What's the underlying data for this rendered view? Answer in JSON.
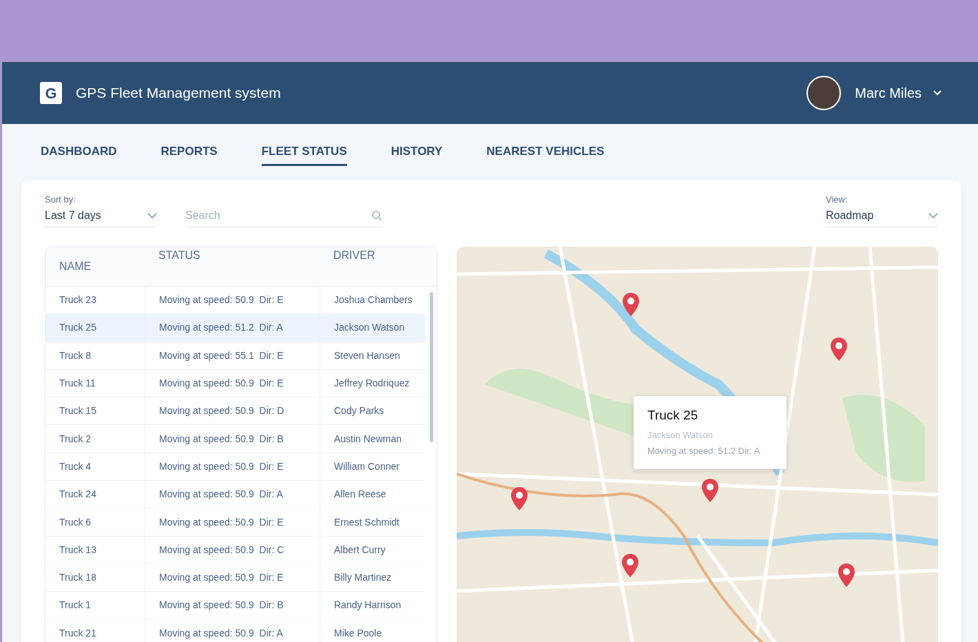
{
  "header": {
    "logo_letter": "G",
    "title": "GPS Fleet Management system",
    "user_name": "Marc Miles"
  },
  "tabs": [
    {
      "label": "DASHBOARD",
      "selected": false
    },
    {
      "label": "REPORTS",
      "selected": false
    },
    {
      "label": "FLEET STATUS",
      "selected": true
    },
    {
      "label": "HISTORY",
      "selected": false
    },
    {
      "label": "NEAREST VEHICLES",
      "selected": false
    }
  ],
  "filters": {
    "sort_label": "Sort by:",
    "sort_value": "Last 7 days",
    "search_placeholder": "Search",
    "view_label": "View:",
    "view_value": "Roadmap"
  },
  "table": {
    "columns": [
      "NAME",
      "STATUS",
      "DRIVER"
    ],
    "rows": [
      {
        "name": "Truck 23",
        "status": "Moving at speed: 50.9  Dir: E",
        "driver": "Joshua Chambers",
        "selected": false
      },
      {
        "name": "Truck 25",
        "status": "Moving at speed: 51.2  Dir: A",
        "driver": "Jackson Watson",
        "selected": true
      },
      {
        "name": "Truck 8",
        "status": "Moving at speed: 55.1  Dir: E",
        "driver": "Steven Hansen",
        "selected": false
      },
      {
        "name": "Truck 11",
        "status": "Moving at speed: 50.9  Dir: E",
        "driver": "Jeffrey Rodriquez",
        "selected": false
      },
      {
        "name": "Truck 15",
        "status": "Moving at speed: 50.9  Dir: D",
        "driver": "Cody Parks",
        "selected": false
      },
      {
        "name": "Truck 2",
        "status": "Moving at speed: 50.9  Dir: B",
        "driver": "Austin Newman",
        "selected": false
      },
      {
        "name": "Truck 4",
        "status": "Moving at speed: 50.9  Dir: E",
        "driver": "William Conner",
        "selected": false
      },
      {
        "name": "Truck 24",
        "status": "Moving at speed: 50.9  Dir: A",
        "driver": "Allen Reese",
        "selected": false
      },
      {
        "name": "Truck 6",
        "status": "Moving at speed: 50.9  Dir: E",
        "driver": "Ernest Schmidt",
        "selected": false
      },
      {
        "name": "Truck 13",
        "status": "Moving at speed: 50.9  Dir: C",
        "driver": "Albert Curry",
        "selected": false
      },
      {
        "name": "Truck 18",
        "status": "Moving at speed: 50.9  Dir: E",
        "driver": "Billy Martinez",
        "selected": false
      },
      {
        "name": "Truck 1",
        "status": "Moving at speed: 50.9  Dir: B",
        "driver": "Randy Harrison",
        "selected": false
      },
      {
        "name": "Truck 21",
        "status": "Moving at speed: 50.9  Dir: A",
        "driver": "Mike Poole",
        "selected": false
      }
    ]
  },
  "map": {
    "tooltip": {
      "title": "Truck 25",
      "driver": "Jackson Watson",
      "status": "Moving at speed: 51.2  Dir: A"
    }
  }
}
